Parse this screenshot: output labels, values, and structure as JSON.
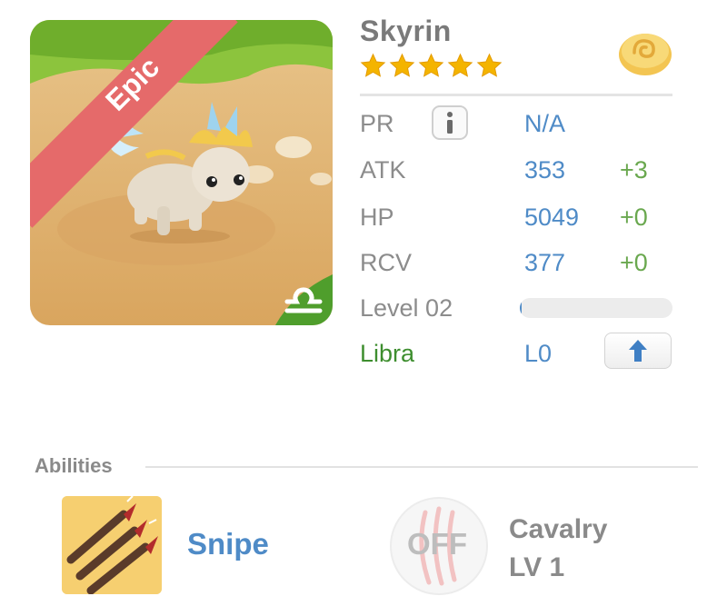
{
  "pet": {
    "name": "Skyrin",
    "rarity": "Epic",
    "stars": 5,
    "zodiac": "Libra",
    "level_text": "Level 02",
    "level_progress": 0.01,
    "lineage_level": "L0",
    "currency_icon": "golden-bun-icon",
    "zodiac_icon": "libra-icon"
  },
  "stats": {
    "pr": {
      "label": "PR",
      "value": "N/A"
    },
    "atk": {
      "label": "ATK",
      "value": "353",
      "bonus": "+3"
    },
    "hp": {
      "label": "HP",
      "value": "5049",
      "bonus": "+0"
    },
    "rcv": {
      "label": "RCV",
      "value": "377",
      "bonus": "+0"
    }
  },
  "abilities": {
    "title": "Abilities",
    "primary": {
      "name": "Snipe",
      "icon": "triple-arrow-icon"
    },
    "secondary": {
      "state": "OFF",
      "name": "Cavalry",
      "level": "LV 1",
      "icon": "claw-mark-icon"
    }
  },
  "colors": {
    "accent_blue": "#4f8bc7",
    "bonus_green": "#6aa84f",
    "zodiac_green": "#3e8e2f",
    "epic_banner": "#e56a6a",
    "star_gold": "#f4b400"
  }
}
